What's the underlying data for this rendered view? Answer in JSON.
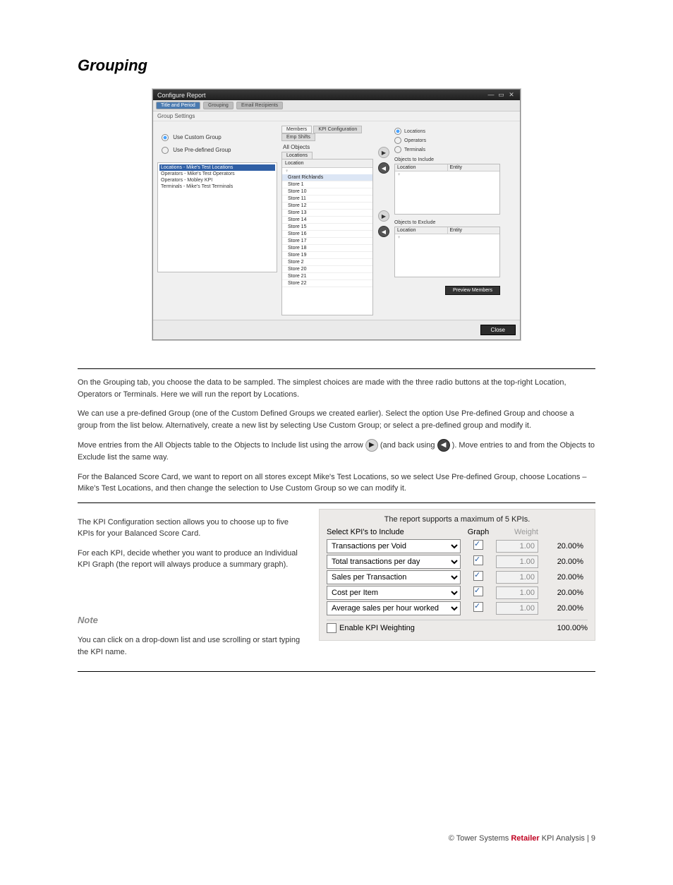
{
  "doc": {
    "heading": "Grouping",
    "hr_above_text": true
  },
  "win": {
    "title": "Configure Report",
    "controls": {
      "min": "—",
      "max": "▭",
      "close": "✕"
    },
    "tabs": [
      "Title and Period",
      "Grouping",
      "Email Recipients"
    ],
    "active_tab": "Title and Period",
    "group_settings_label": "Group Settings",
    "subtabs": [
      "Members",
      "KPI Configuration",
      "Emp Shifts"
    ],
    "active_subtab": "Members",
    "radio_left": {
      "custom": "Use Custom Group",
      "predef": "Use Pre-defined Group",
      "selected": "custom"
    },
    "predef_list": {
      "items": [
        "Locations - Mike's Test Locations",
        "Operators - Mike's Test Operators",
        "Operators - Mobley KPI",
        "Terminals - Mike's Test Terminals"
      ],
      "selected_index": 0
    },
    "all_objects_label": "All Objects",
    "locations_tab": "Locations",
    "location_header": "Location",
    "filter_glyph": "♀",
    "locations": [
      "Grant Richlands",
      "Store 1",
      "Store 10",
      "Store 11",
      "Store 12",
      "Store 13",
      "Store 14",
      "Store 15",
      "Store 16",
      "Store 17",
      "Store 18",
      "Store 19",
      "Store 2",
      "Store 20",
      "Store 21",
      "Store 22"
    ],
    "selected_location_index": 0,
    "radio_right": {
      "locations": "Locations",
      "operators": "Operators",
      "terminals": "Terminals",
      "selected": "locations"
    },
    "include_label": "Objects to Include",
    "exclude_label": "Objects to Exclude",
    "table_headers": {
      "location": "Location",
      "entity": "Entity"
    },
    "preview_button": "Preview Members",
    "close_button": "Close"
  },
  "body1": {
    "p1": "On the Grouping tab, you choose the data to be sampled. The simplest choices are made with the three radio buttons at the top-right Location, Operators or Terminals. Here we will run the report by Locations.",
    "p2": "We can use a pre-defined Group (one of the Custom Defined Groups we created earlier). Select the option Use Pre-defined Group and choose a group from the list below. Alternatively, create a new list by selecting Use Custom Group; or select a pre-defined group and modify it.",
    "p3_a": "Move entries from the All Objects table to the Objects to Include list using the arrow ",
    "p3_b": " (and back using ",
    "p3_c": " ). Move entries to and from the Objects to Exclude list the same way.",
    "p4": "For the Balanced Score Card, we want to report on all stores except Mike's Test Locations, so we select Use Pre-defined Group, choose Locations – Mike's Test Locations, and then change the selection to Use Custom Group so we can modify it."
  },
  "kpi": {
    "caption": "The report supports a maximum of 5 KPIs.",
    "select_label": "Select KPI's to Include",
    "graph_label": "Graph",
    "weight_label": "Weight",
    "rows": [
      {
        "name": "Transactions per Void",
        "graph": true,
        "weight": "1.00",
        "pct": "20.00%"
      },
      {
        "name": "Total transactions per day",
        "graph": true,
        "weight": "1.00",
        "pct": "20.00%"
      },
      {
        "name": "Sales per Transaction",
        "graph": true,
        "weight": "1.00",
        "pct": "20.00%"
      },
      {
        "name": "Cost per Item",
        "graph": true,
        "weight": "1.00",
        "pct": "20.00%"
      },
      {
        "name": "Average sales per hour worked",
        "graph": true,
        "weight": "1.00",
        "pct": "20.00%"
      }
    ],
    "enable_label": "Enable KPI Weighting",
    "total": "100.00%"
  },
  "kpi_left": {
    "p1": "The KPI Configuration section allows you to choose up to five KPIs for your Balanced Score Card.",
    "p2": "For each KPI, decide whether you want to produce an Individual KPI Graph (the report will always produce a summary graph).",
    "note_label": "Note",
    "note_body": "You can click on a drop-down list and use scrolling or start typing the KPI name."
  },
  "footer": {
    "text_a": "© Tower Systems ",
    "text_b": "Retailer",
    "text_c": " KPI Analysis | 9"
  }
}
